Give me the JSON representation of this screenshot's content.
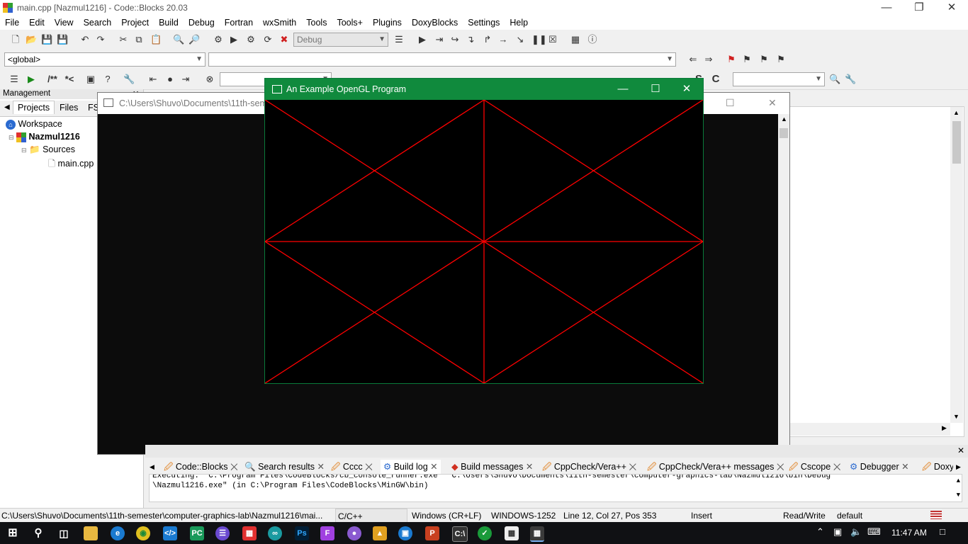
{
  "window": {
    "title": "main.cpp [Nazmul1216] - Code::Blocks 20.03"
  },
  "menu": [
    "File",
    "Edit",
    "View",
    "Search",
    "Project",
    "Build",
    "Debug",
    "Fortran",
    "wxSmith",
    "Tools",
    "Tools+",
    "Plugins",
    "DoxyBlocks",
    "Settings",
    "Help"
  ],
  "toolbar": {
    "build_target": "Debug",
    "scope": "<global>"
  },
  "management": {
    "title": "Management",
    "tabs": [
      "Projects",
      "Files",
      "FS"
    ],
    "tree": {
      "workspace": "Workspace",
      "project": "Nazmul1216",
      "folder": "Sources",
      "file": "main.cpp"
    }
  },
  "console": {
    "title": "C:\\Users\\Shuvo\\Documents\\11th-seme"
  },
  "opengl": {
    "title": "An Example OpenGL Program",
    "line_color": "#ff0000",
    "background": "#000000"
  },
  "log_tabs": [
    "Code::Blocks",
    "Search results",
    "Cccc",
    "Build log",
    "Build messages",
    "CppCheck/Vera++",
    "CppCheck/Vera++ messages",
    "Cscope",
    "Debugger",
    "DoxyB"
  ],
  "log": {
    "line1": "Executing:  \"C:\\Program Files\\CodeBlocks/cb_console_runner.exe\"  \"C:\\Users\\Shuvo\\Documents\\11th-semester\\computer-graphics-lab\\Nazmul1216\\bin\\Debug",
    "line2": "\\Nazmul1216.exe\"  (in C:\\Program Files\\CodeBlocks\\MinGW\\bin)"
  },
  "status": {
    "path": "C:\\Users\\Shuvo\\Documents\\11th-semester\\computer-graphics-lab\\Nazmul1216\\mai...",
    "lang": "C/C++",
    "eol": "Windows (CR+LF)",
    "encoding": "WINDOWS-1252",
    "position": "Line 12, Col 27, Pos 353",
    "mode": "Insert",
    "access": "Read/Write",
    "profile": "default"
  },
  "taskbar": {
    "time": "11:47 AM"
  }
}
